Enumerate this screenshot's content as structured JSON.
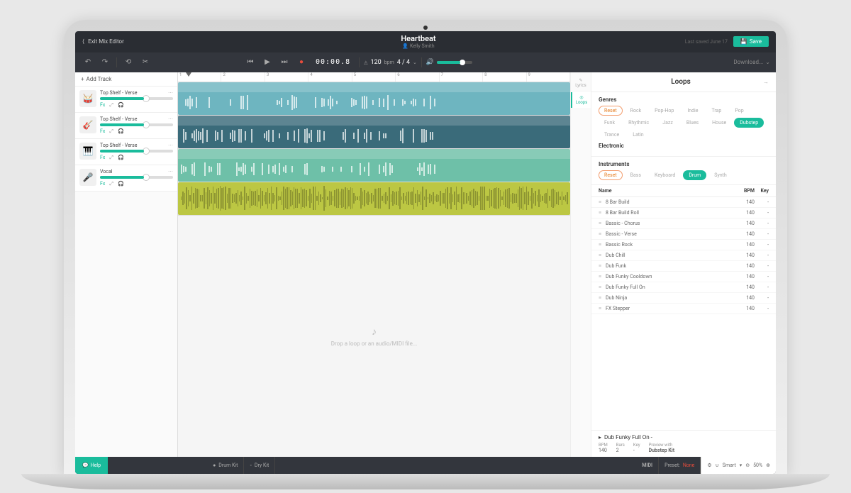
{
  "header": {
    "exit_label": "Exit Mix Editor",
    "title": "Heartbeat",
    "author": "Kelly Smith",
    "last_saved": "Last saved June 17",
    "save_label": "Save"
  },
  "transport": {
    "timecode": "00:00.8",
    "bpm": "120",
    "bpm_label": "bpm",
    "time_sig": "4 / 4",
    "download_label": "Download..."
  },
  "tracks_panel": {
    "add_label": "Add Track",
    "tracks": [
      {
        "name": "Top Shelf - Verse",
        "icon": "🥁"
      },
      {
        "name": "Top Shelf - Verse",
        "icon": "🎸"
      },
      {
        "name": "Top Shelf - Verse",
        "icon": "🎹"
      },
      {
        "name": "Vocal",
        "icon": "🎤"
      }
    ]
  },
  "ruler": [
    "1",
    "2",
    "3",
    "4",
    "5",
    "6",
    "7",
    "8",
    "9"
  ],
  "dropzone_text": "Drop a loop or an audio/MIDI file...",
  "panel_tabs": {
    "lyrics": "Lyrics",
    "loops": "Loops"
  },
  "loops": {
    "title": "Loops",
    "genres_label": "Genres",
    "electronic_label": "Electronic",
    "genres": [
      "Reset",
      "Rock",
      "Pop-Hop",
      "Indie",
      "Trap",
      "Pop",
      "Funk",
      "Rhythmic",
      "Jazz",
      "Blues",
      "House",
      "Dubstep",
      "Trance",
      "Latin"
    ],
    "genres_active": "Dubstep",
    "instruments_label": "Instruments",
    "instruments": [
      "Reset",
      "Bass",
      "Keyboard",
      "Drum",
      "Synth"
    ],
    "instruments_active": "Drum",
    "cols": {
      "name": "Name",
      "bpm": "BPM",
      "key": "Key"
    },
    "items": [
      {
        "name": "8 Bar Build",
        "bpm": "140",
        "key": "-"
      },
      {
        "name": "8 Bar Build Roll",
        "bpm": "140",
        "key": "-"
      },
      {
        "name": "Bassic - Chorus",
        "bpm": "140",
        "key": "-"
      },
      {
        "name": "Bassic - Verse",
        "bpm": "140",
        "key": "-"
      },
      {
        "name": "Bassic Rock",
        "bpm": "140",
        "key": "-"
      },
      {
        "name": "Dub Chill",
        "bpm": "140",
        "key": "-"
      },
      {
        "name": "Dub Funk",
        "bpm": "140",
        "key": "-"
      },
      {
        "name": "Dub Funky Cooldown",
        "bpm": "140",
        "key": "-"
      },
      {
        "name": "Dub Funky Full On",
        "bpm": "140",
        "key": "-"
      },
      {
        "name": "Dub Ninja",
        "bpm": "140",
        "key": "-"
      },
      {
        "name": "FX Stepper",
        "bpm": "140",
        "key": "-"
      }
    ],
    "selected": {
      "name": "Dub Funky Full On -",
      "bpm_label": "BPM",
      "bpm": "140",
      "bars_label": "Bars",
      "bars": "2",
      "key_label": "Key",
      "key": "-",
      "preview_label": "Preview with",
      "preview": "Dubstep Kit"
    }
  },
  "bottombar": {
    "help": "Help",
    "instrument": "Drum Kit",
    "preset": "Dry Kit",
    "midi": "MIDI",
    "preset_label": "Preset:",
    "preset_val": "None",
    "smart": "Smart",
    "zoom": "50%"
  }
}
